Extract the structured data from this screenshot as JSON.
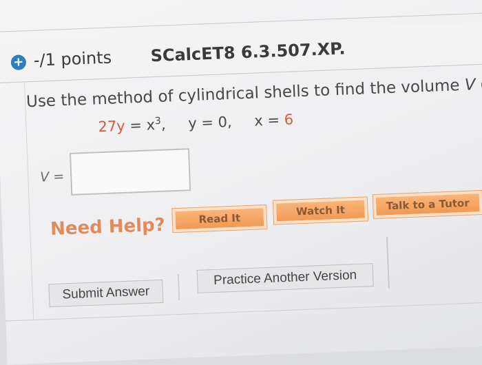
{
  "header": {
    "plus_icon": "+",
    "points": "-/1 points",
    "problem_id": "SCalcET8 6.3.507.XP."
  },
  "question": {
    "text_before_var": "Use the method of cylindrical shells to find the volume ",
    "var": "V",
    "text_after_var": " ge"
  },
  "equations": {
    "eq1_lhs": "27y",
    "eq1_rhs_prefix": " = x",
    "eq1_exponent": "3",
    "eq1_sep": ",",
    "eq2": "y = 0,",
    "eq3_prefix": "x = ",
    "eq3_value": "6"
  },
  "answer": {
    "label_var": "V",
    "label_eq": " =",
    "value": ""
  },
  "help": {
    "title": "Need Help?",
    "read_label": "Read It",
    "watch_label": "Watch It",
    "tutor_label": "Talk to a Tutor"
  },
  "actions": {
    "submit_label": "Submit Answer",
    "practice_label": "Practice Another Version"
  },
  "colors": {
    "accent_red": "#d95a40",
    "help_orange": "#f19a55",
    "plus_blue": "#2d7fbd"
  }
}
